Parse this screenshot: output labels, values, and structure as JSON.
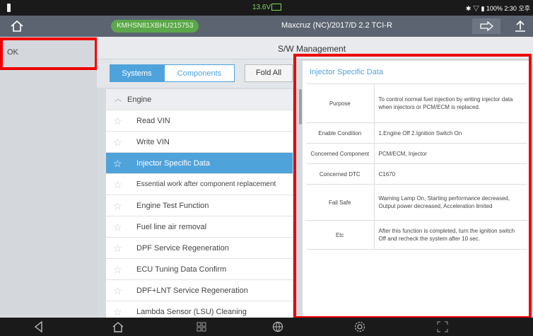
{
  "status": {
    "voltage": "13.6V",
    "right": "✱ ▽ ▮ 100% 2:30 오후"
  },
  "titlebar": {
    "vin": "KMHSN81XBHU215753",
    "vehicle": "Maxcruz (NC)/2017/D 2.2 TCI-R"
  },
  "left_panel": {
    "ok_label": "OK"
  },
  "header": {
    "title": "S/W Management"
  },
  "tabs": {
    "systems": "Systems",
    "components": "Components",
    "fold_all": "Fold All"
  },
  "list": {
    "section": "Engine",
    "items": [
      "Read VIN",
      "Write VIN",
      "Injector Specific Data",
      "Essential work after component replacement",
      "Engine Test Function",
      "Fuel line air removal",
      "DPF Service Regeneration",
      "ECU Tuning Data Confirm",
      "DPF+LNT Service Regeneration",
      "Lambda Sensor (LSU) Cleaning"
    ],
    "selected_index": 2
  },
  "detail": {
    "title": "Injector Specific Data",
    "rows": [
      {
        "key": "Purpose",
        "value": "To control normal fuel injection by writing injector data when injectors or PCM/ECM is replaced."
      },
      {
        "key": "Enable Condition",
        "value": "1.Engine Off 2.Ignition Switch On"
      },
      {
        "key": "Concerned Component",
        "value": "PCM/ECM, Injector"
      },
      {
        "key": "Concerned DTC",
        "value": "C1670"
      },
      {
        "key": "Fail Safe",
        "value": "Warning Lamp On, Starting performance decreased, Output power decreased, Acceleration limited"
      },
      {
        "key": "Etc",
        "value": "After this function is completed, turn the ignition switch Off and recheck the system after 10 sec."
      }
    ]
  },
  "colors": {
    "accent": "#4fa3db",
    "highlight_box": "#e00000",
    "vin_pill": "#5ba84a"
  }
}
